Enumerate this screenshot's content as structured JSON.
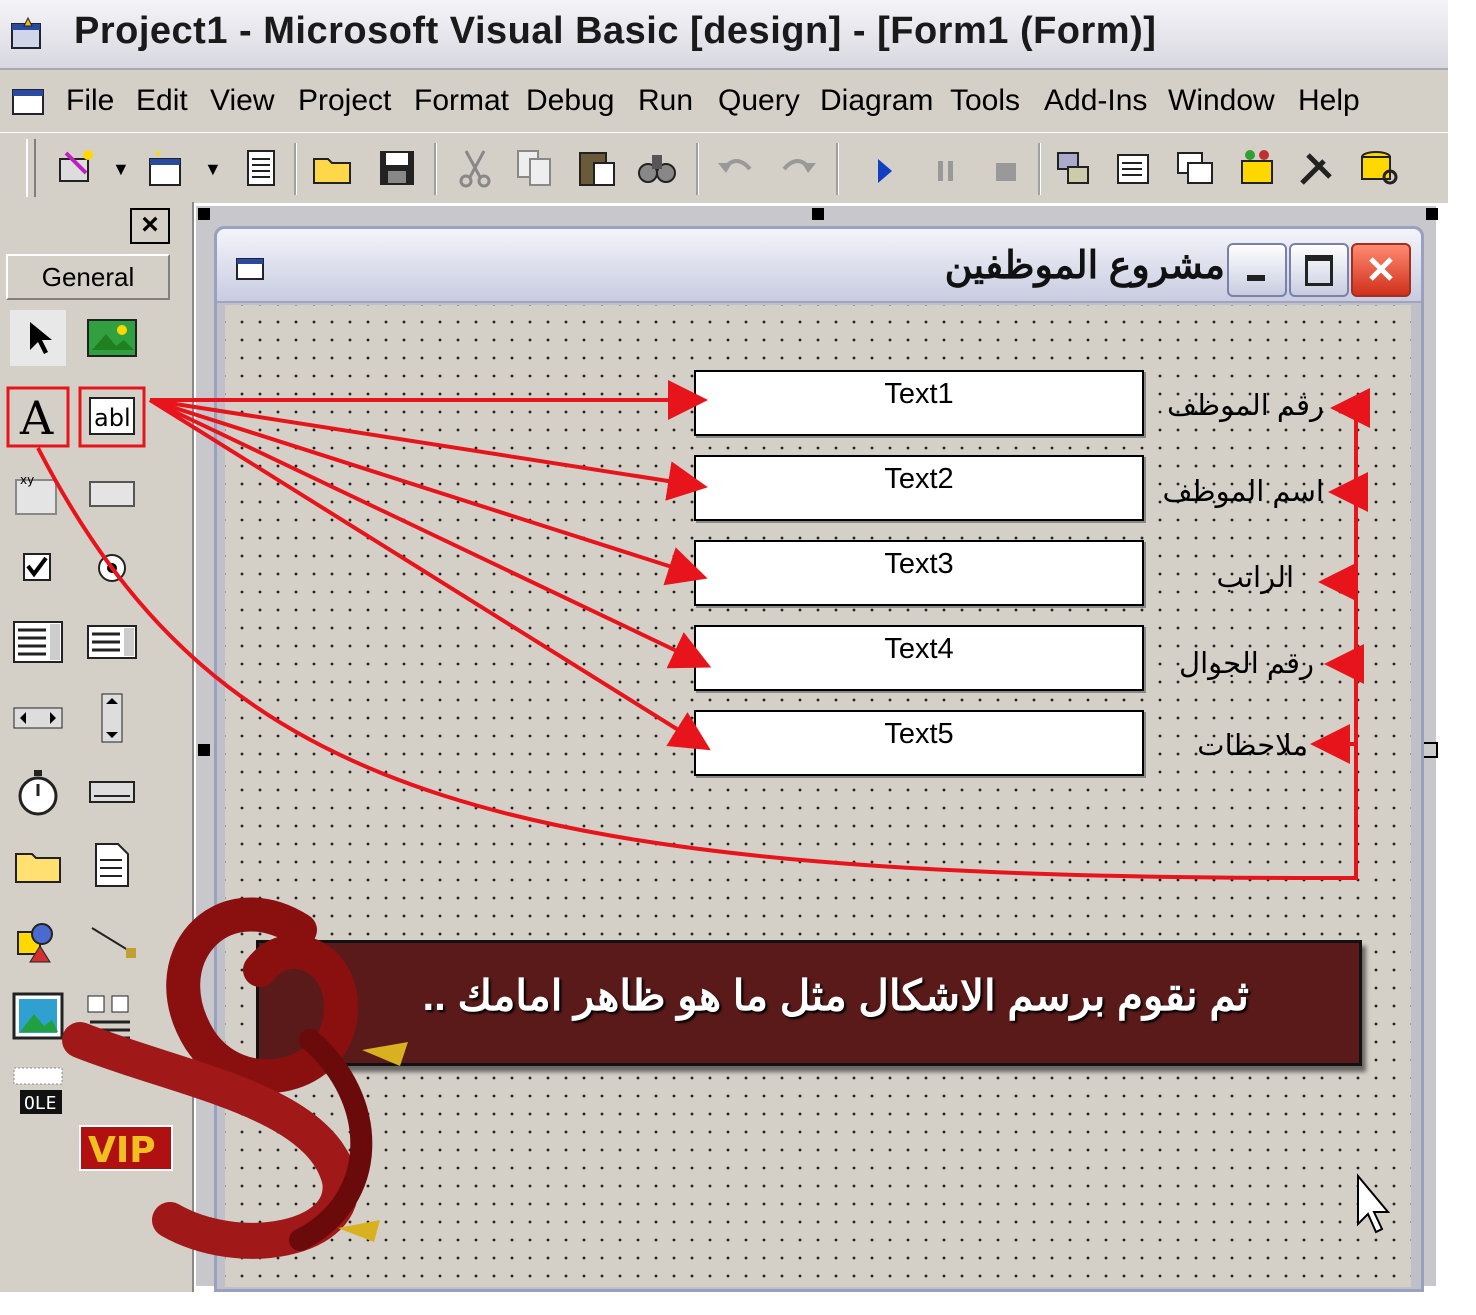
{
  "window": {
    "title": "Project1 - Microsoft Visual Basic [design] - [Form1 (Form)]"
  },
  "menu": [
    "File",
    "Edit",
    "View",
    "Project",
    "Format",
    "Debug",
    "Run",
    "Query",
    "Diagram",
    "Tools",
    "Add-Ins",
    "Window",
    "Help"
  ],
  "toolbox": {
    "close_label": "×",
    "tab_label": "General",
    "tools": [
      "pointer-icon",
      "picturebox-icon",
      "label-icon",
      "textbox-icon",
      "frame-icon",
      "commandbutton-icon",
      "checkbox-icon",
      "optionbutton-icon",
      "combobox-icon",
      "listbox-icon",
      "hscrollbar-icon",
      "vscrollbar-icon",
      "timer-icon",
      "drivelistbox-icon",
      "dirlistbox-icon",
      "filelistbox-icon",
      "shape-icon",
      "line-icon",
      "image-icon",
      "data-icon",
      "ole-icon"
    ],
    "ole_label": "OLE"
  },
  "form": {
    "title": "مشروع الموظفين",
    "textboxes": [
      "Text1",
      "Text2",
      "Text3",
      "Text4",
      "Text5"
    ],
    "labels": [
      "رقم الموظف",
      "اسم الموظف",
      "الراتب",
      "رقم الجوال",
      "ملاحظات"
    ]
  },
  "banner": {
    "text": "ثم نقوم برسم الاشكال مثل ما هو ظاهر امامك .."
  },
  "watermark": {
    "badge": "VIP"
  },
  "colors": {
    "annotation": "#e8141c",
    "banner": "#5a1a1a",
    "menu_bg": "#d4d0c8"
  }
}
